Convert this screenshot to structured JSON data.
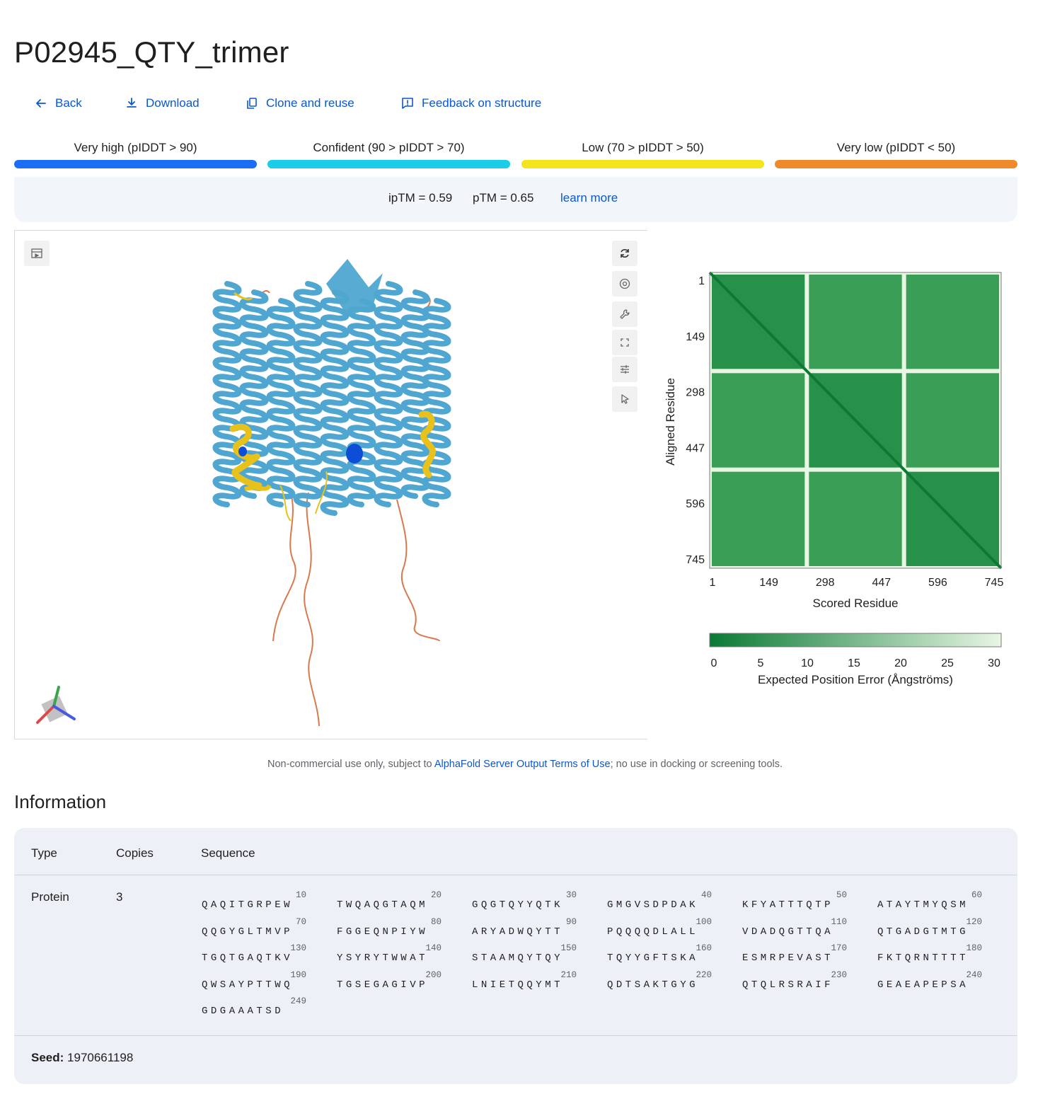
{
  "page": {
    "title": "P02945_QTY_trimer"
  },
  "actions": {
    "back": "Back",
    "download": "Download",
    "clone": "Clone and reuse",
    "feedback": "Feedback on structure"
  },
  "plddt_legend": [
    {
      "label": "Very high (pIDDT > 90)",
      "color": "#1a6ef5"
    },
    {
      "label": "Confident (90 > pIDDT > 70)",
      "color": "#1ccde8"
    },
    {
      "label": "Low (70 > pIDDT > 50)",
      "color": "#f3e41c"
    },
    {
      "label": "Very low (pIDDT < 50)",
      "color": "#ef8a2a"
    }
  ],
  "scores": {
    "iptm": "ipTM = 0.59",
    "ptm": "pTM = 0.65",
    "learn_more": "learn more"
  },
  "viewer": {
    "icons": [
      "sequence-panel-icon",
      "reset-view-icon",
      "screenshot-icon",
      "settings-icon",
      "fullscreen-icon",
      "controls-icon",
      "select-mode-icon"
    ],
    "helix_color": "#4fa6d0",
    "low_color": "#e8c11a",
    "very_low_color": "#d9794f",
    "very_high_color": "#0e4ed6"
  },
  "pae": {
    "ylabel": "Aligned Residue",
    "xlabel": "Scored Residue",
    "ticks": [
      "1",
      "149",
      "298",
      "447",
      "596",
      "745"
    ],
    "colorbar_ticks": [
      "0",
      "5",
      "10",
      "15",
      "20",
      "25",
      "30"
    ],
    "colorbar_label": "Expected Position Error (Ångströms)",
    "color_low": "#0b7a35",
    "color_high": "#e8f6e3"
  },
  "note": {
    "prefix": "Non-commercial use only, subject to ",
    "link": "AlphaFold Server Output Terms of Use",
    "suffix": "; no use in docking or screening tools."
  },
  "info": {
    "heading": "Information",
    "headers": {
      "type": "Type",
      "copies": "Copies",
      "sequence": "Sequence"
    },
    "row": {
      "type": "Protein",
      "copies": "3"
    },
    "sequence_chunks": [
      {
        "num": "10",
        "res": "QAQITGRPEW"
      },
      {
        "num": "20",
        "res": "TWQAQGTAQM"
      },
      {
        "num": "30",
        "res": "GQGTQYYQTK"
      },
      {
        "num": "40",
        "res": "GMGVSDPDAK"
      },
      {
        "num": "50",
        "res": "KFYATTTQTP"
      },
      {
        "num": "60",
        "res": "ATAYTMYQSM"
      },
      {
        "num": "70",
        "res": "QQGYGLTMVP"
      },
      {
        "num": "80",
        "res": "FGGEQNPIYW"
      },
      {
        "num": "90",
        "res": "ARYADWQYTT"
      },
      {
        "num": "100",
        "res": "PQQQQDLALL"
      },
      {
        "num": "110",
        "res": "VDADQGTTQA"
      },
      {
        "num": "120",
        "res": "QTGADGTMTG"
      },
      {
        "num": "130",
        "res": "TGQTGAQTKV"
      },
      {
        "num": "140",
        "res": "YSYRYTWWAT"
      },
      {
        "num": "150",
        "res": "STAAMQYTQY"
      },
      {
        "num": "160",
        "res": "TQYYGFTSKA"
      },
      {
        "num": "170",
        "res": "ESMRPEVAST"
      },
      {
        "num": "180",
        "res": "FKTQRNTTTT"
      },
      {
        "num": "190",
        "res": "QWSAYPTTWQ"
      },
      {
        "num": "200",
        "res": "TGSEGAGIVP"
      },
      {
        "num": "210",
        "res": "LNIETQQYMT"
      },
      {
        "num": "220",
        "res": "QDTSAKTGYG"
      },
      {
        "num": "230",
        "res": "QTQLRSRAIF"
      },
      {
        "num": "240",
        "res": "GEAEAPEPSA"
      },
      {
        "num": "249",
        "res": "GDGAAATSD"
      }
    ],
    "seed_label": "Seed:",
    "seed_value": "1970661198"
  }
}
